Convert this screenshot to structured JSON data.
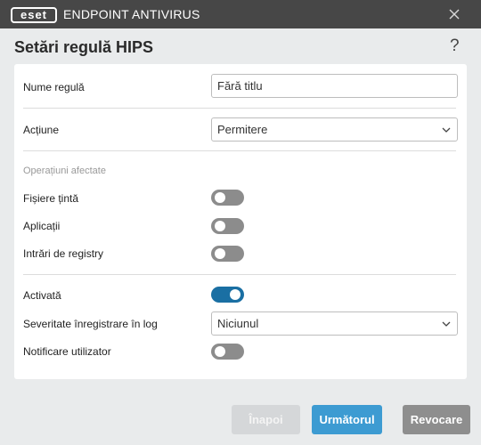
{
  "titlebar": {
    "logo_text": "eset",
    "app_name": "ENDPOINT ANTIVIRUS"
  },
  "dialog": {
    "title": "Setări regulă HIPS",
    "help": "?"
  },
  "form": {
    "rule_name_label": "Nume regulă",
    "rule_name_value": "Fără titlu",
    "action_label": "Acțiune",
    "action_value": "Permitere",
    "affected_ops_label": "Operațiuni afectate",
    "target_files_label": "Fișiere țintă",
    "target_files_on": false,
    "applications_label": "Aplicații",
    "applications_on": false,
    "registry_label": "Intrări de registry",
    "registry_on": false,
    "enabled_label": "Activată",
    "enabled_on": true,
    "log_severity_label": "Severitate înregistrare în log",
    "log_severity_value": "Niciunul",
    "notify_label": "Notificare utilizator",
    "notify_on": false
  },
  "buttons": {
    "back": "Înapoi",
    "next": "Următorul",
    "cancel": "Revocare"
  },
  "colors": {
    "titlebar": "#474747",
    "toggle_on": "#1a6fa3",
    "toggle_off": "#8c8c8c",
    "primary": "#3d9bd2",
    "cancel": "#8e8e8e",
    "disabled": "#d5d7d9"
  }
}
